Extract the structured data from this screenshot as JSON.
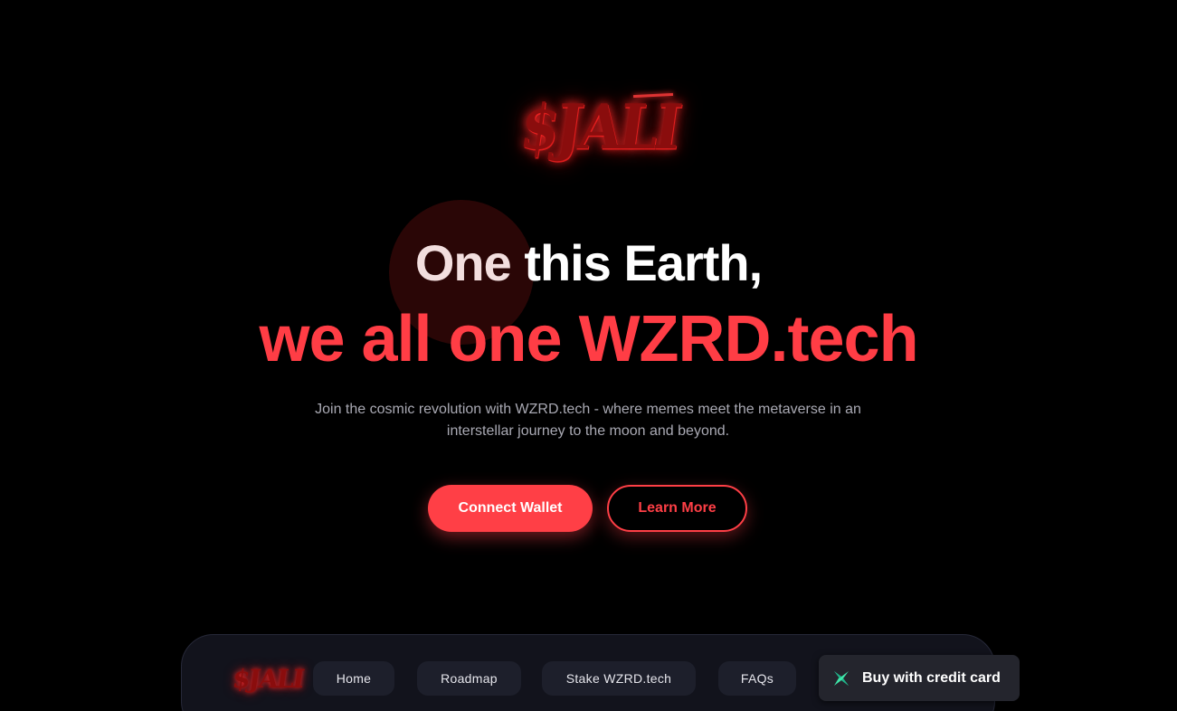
{
  "hero": {
    "logo_text": "$JALI",
    "headline_first": "One",
    "headline_rest": " this Earth,",
    "headline_line2": "we all one WZRD.tech",
    "subtitle": "Join the cosmic revolution with WZRD.tech - where memes meet the metaverse in an interstellar journey to the moon and beyond.",
    "connect_wallet_label": "Connect Wallet",
    "learn_more_label": "Learn More"
  },
  "navbar": {
    "logo_text": "$JALI",
    "items": [
      {
        "label": "Home"
      },
      {
        "label": "Roadmap"
      },
      {
        "label": "Stake WZRD.tech"
      },
      {
        "label": "FAQs"
      }
    ],
    "buy_label": "Buy with credit card",
    "buy_icon": "cross-x-icon"
  },
  "colors": {
    "background": "#000000",
    "accent": "#ff3f46",
    "navbar_bg": "#12131c",
    "pill_bg": "#1d1f2b",
    "buy_icon": "#3ee6a8"
  }
}
